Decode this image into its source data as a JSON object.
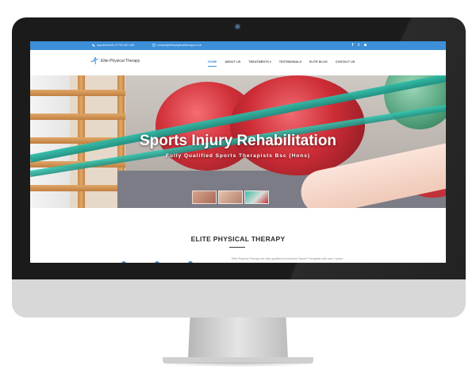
{
  "topbar": {
    "phone": "Appointments 07793 457 445",
    "email": "contact@elitephysicaltherapy.co.uk",
    "social": [
      {
        "icon": "facebook-icon",
        "glyph": "f"
      },
      {
        "icon": "twitter-icon",
        "glyph": "t"
      },
      {
        "icon": "instagram-icon",
        "glyph": "◙"
      }
    ]
  },
  "brand": {
    "name": "Elite Physical Therapy",
    "accent": "#3d8fd8"
  },
  "nav": {
    "items": [
      {
        "label": "HOME",
        "active": true
      },
      {
        "label": "ABOUT US"
      },
      {
        "label": "TREATMENTS",
        "caret": "▾"
      },
      {
        "label": "TESTIMONIALS"
      },
      {
        "label": "ELITE BLOG"
      },
      {
        "label": "CONTACT US"
      }
    ]
  },
  "hero": {
    "title": "Sports Injury Rehabilitation",
    "subtitle": "Fully Qualified Sports Therapists Bsc (Hons)"
  },
  "about": {
    "title": "ELITE PHYSICAL THERAPY",
    "intro": "Elite Physical Therapy are fully qualified and insured Sports Therapists with over x years"
  }
}
